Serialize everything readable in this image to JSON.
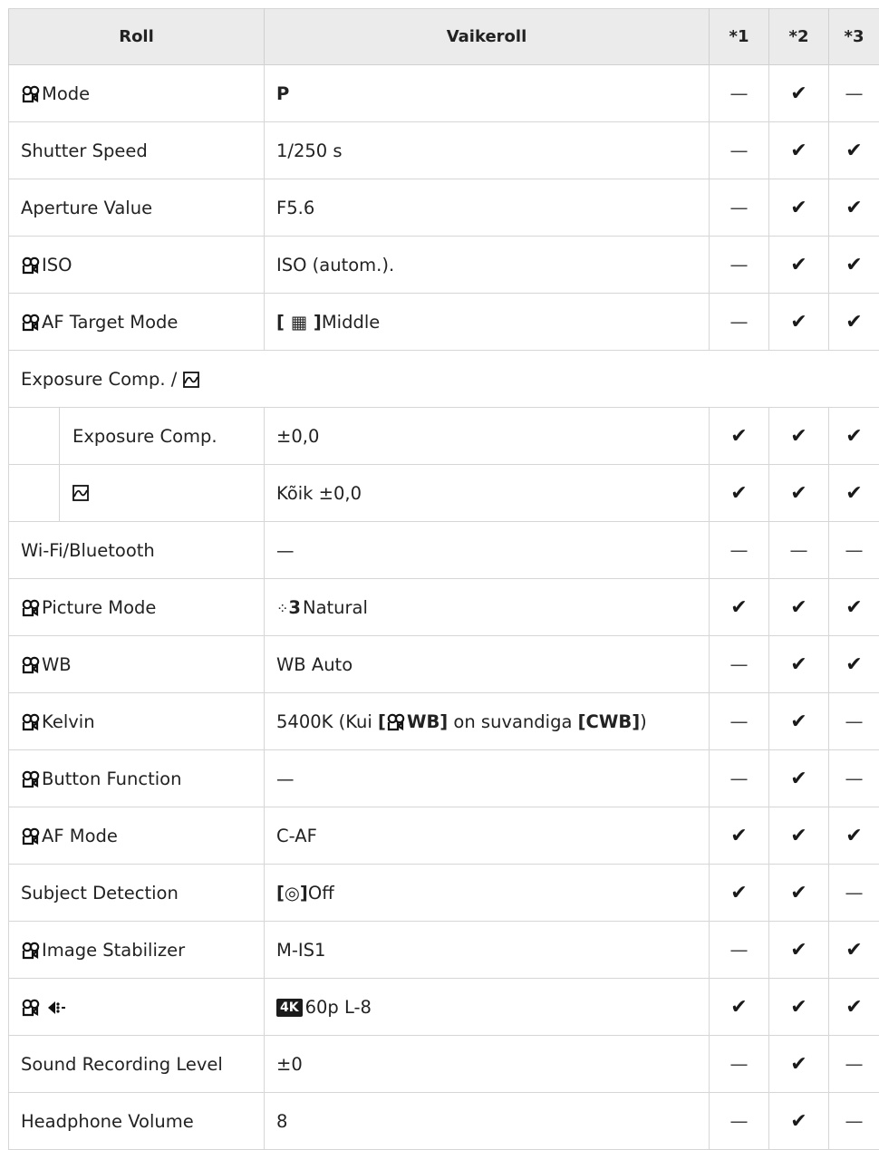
{
  "header": {
    "roll": "Roll",
    "default": "Vaikeroll",
    "c1": "*1",
    "c2": "*2",
    "c3": "*3"
  },
  "rows": [
    {
      "label": "Mode",
      "movie_icon": true,
      "value": "P",
      "c1": "—",
      "c2": "✔",
      "c3": "—"
    },
    {
      "label": "Shutter Speed",
      "value": "1/250 s",
      "c1": "—",
      "c2": "✔",
      "c3": "✔"
    },
    {
      "label": "Aperture Value",
      "value": "F5.6",
      "c1": "—",
      "c2": "✔",
      "c3": "✔"
    },
    {
      "label": "ISO",
      "movie_icon": true,
      "value": "ISO (autom.).",
      "c1": "—",
      "c2": "✔",
      "c3": "✔"
    },
    {
      "label": "AF Target Mode",
      "movie_icon": true,
      "value_prefix": "[ ▦ ]",
      "value": "Middle",
      "c1": "—",
      "c2": "✔",
      "c3": "✔"
    },
    {
      "label": "Exposure Comp. /",
      "group": true
    },
    {
      "label": "Exposure Comp.",
      "sub": true,
      "value": "±0,0",
      "c1": "✔",
      "c2": "✔",
      "c3": "✔"
    },
    {
      "label": "",
      "sub": true,
      "icon_only": "highlight-shadow-icon",
      "value": "Kõik ±0,0",
      "c1": "✔",
      "c2": "✔",
      "c3": "✔"
    },
    {
      "label": "Wi-Fi/Bluetooth",
      "value": "—",
      "c1": "—",
      "c2": "—",
      "c3": "—"
    },
    {
      "label": "Picture Mode",
      "movie_icon": true,
      "value_prefix": "3",
      "value": "Natural",
      "c1": "✔",
      "c2": "✔",
      "c3": "✔"
    },
    {
      "label": "WB",
      "movie_icon": true,
      "value": "WB Auto",
      "c1": "—",
      "c2": "✔",
      "c3": "✔"
    },
    {
      "label": "Kelvin",
      "movie_icon": true,
      "value_parts": [
        "5400K (Kui ",
        "[",
        "WB]",
        " on suvandiga ",
        "[CWB]",
        ")"
      ],
      "c1": "—",
      "c2": "✔",
      "c3": "—"
    },
    {
      "label": "Button Function",
      "movie_icon": true,
      "value": "—",
      "c1": "—",
      "c2": "✔",
      "c3": "—"
    },
    {
      "label": "AF Mode",
      "movie_icon": true,
      "value": "C-AF",
      "c1": "✔",
      "c2": "✔",
      "c3": "✔"
    },
    {
      "label": "Subject Detection",
      "value_prefix": "[◎]",
      "value": "Off",
      "c1": "✔",
      "c2": "✔",
      "c3": "—"
    },
    {
      "label": "Image Stabilizer",
      "movie_icon": true,
      "value": "M-IS1",
      "c1": "—",
      "c2": "✔",
      "c3": "✔"
    },
    {
      "label": "",
      "movie_icon": true,
      "icon_only": "image-quality-icon",
      "value_prefix": "4K",
      "value": "60p L-8",
      "c1": "✔",
      "c2": "✔",
      "c3": "✔"
    },
    {
      "label": "Sound Recording Level",
      "value": "±0",
      "c1": "—",
      "c2": "✔",
      "c3": "—"
    },
    {
      "label": "Headphone Volume",
      "value": "8",
      "c1": "—",
      "c2": "✔",
      "c3": "—"
    }
  ]
}
